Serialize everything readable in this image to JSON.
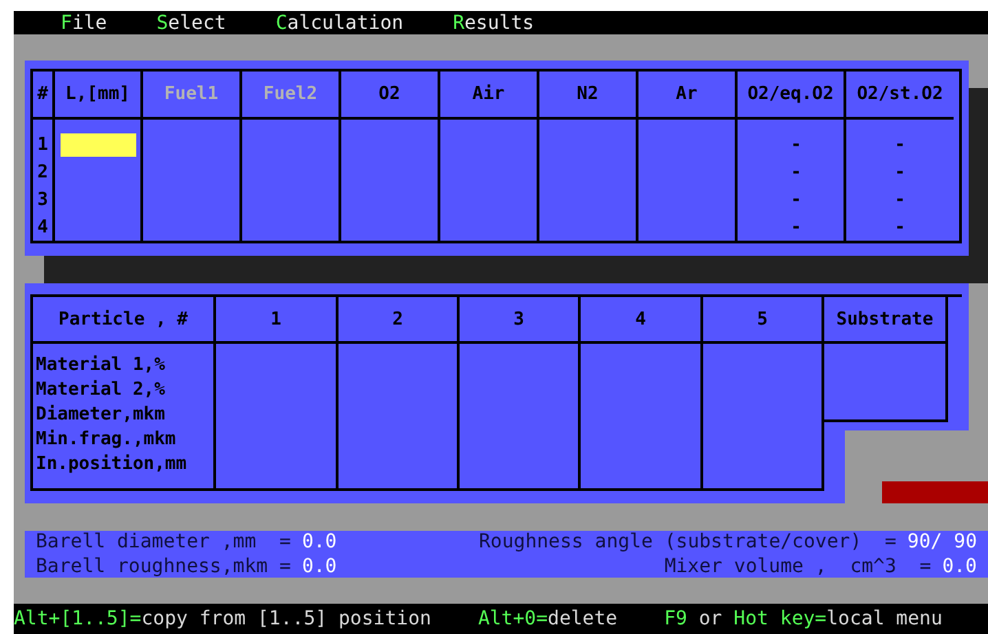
{
  "menu": [
    {
      "label": "File"
    },
    {
      "label": "Select"
    },
    {
      "label": "Calculation"
    },
    {
      "label": "Results"
    }
  ],
  "gas_table": {
    "columns": [
      {
        "label": "#",
        "disabled": false
      },
      {
        "label": "L,[mm]",
        "disabled": false
      },
      {
        "label": "Fuel1",
        "disabled": true
      },
      {
        "label": "Fuel2",
        "disabled": true
      },
      {
        "label": "O2",
        "disabled": false
      },
      {
        "label": "Air",
        "disabled": false
      },
      {
        "label": "N2",
        "disabled": false
      },
      {
        "label": "Ar",
        "disabled": false
      },
      {
        "label": "O2/eq.O2",
        "disabled": false
      },
      {
        "label": "O2/st.O2",
        "disabled": false
      }
    ],
    "rows": [
      {
        "number": "1",
        "l_selected": true,
        "o2_eq": "-",
        "o2_st": "-"
      },
      {
        "number": "2",
        "l_selected": false,
        "o2_eq": "-",
        "o2_st": "-"
      },
      {
        "number": "3",
        "l_selected": false,
        "o2_eq": "-",
        "o2_st": "-"
      },
      {
        "number": "4",
        "l_selected": false,
        "o2_eq": "-",
        "o2_st": "-"
      }
    ]
  },
  "particle_table": {
    "columns": [
      "Particle , #",
      "1",
      "2",
      "3",
      "4",
      "5",
      "Substrate"
    ],
    "row_labels": [
      "Material 1,%",
      "Material 2,%",
      "Diameter,mkm",
      "Min.frag.,mkm",
      "In.position,mm"
    ]
  },
  "parameters": [
    {
      "label": "Barell diameter ,mm  =",
      "value": "0.0"
    },
    {
      "label": "Roughness angle (substrate/cover)  =",
      "value": "90/ 90"
    },
    {
      "label": "Barell roughness,mkm =",
      "value": "0.0"
    },
    {
      "label": "Mixer volume ,  cm^3  =",
      "value": "0.0"
    }
  ],
  "status_bar": [
    {
      "parts": [
        {
          "kind": "key",
          "text": "Alt+[1..5]="
        },
        {
          "kind": "text",
          "text": "copy from [1..5] position"
        }
      ]
    },
    {
      "parts": [
        {
          "kind": "key",
          "text": "Alt+0="
        },
        {
          "kind": "text",
          "text": "delete"
        }
      ]
    },
    {
      "parts": [
        {
          "kind": "key",
          "text": "F9"
        },
        {
          "kind": "text",
          "text": " or "
        },
        {
          "kind": "key",
          "text": "Hot key="
        },
        {
          "kind": "text",
          "text": "local menu"
        }
      ]
    }
  ]
}
